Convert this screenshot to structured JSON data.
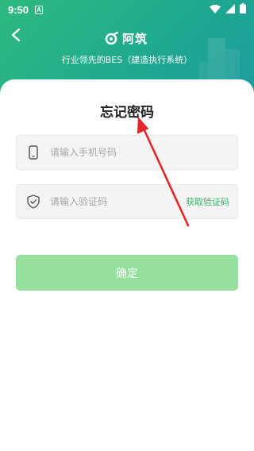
{
  "status_bar": {
    "time": "9:50",
    "app_badge": "A",
    "icons": [
      "wifi-icon",
      "signal-icon",
      "battery-icon"
    ]
  },
  "header": {
    "back_icon": "chevron-left-icon",
    "logo_text": "阿筑",
    "subtitle": "行业领先的BES（建造执行系统）"
  },
  "form": {
    "title": "忘记密码",
    "phone": {
      "placeholder": "请输入手机号码",
      "value": "",
      "icon": "phone-icon"
    },
    "code": {
      "placeholder": "请输入验证码",
      "value": "",
      "icon": "shield-check-icon"
    },
    "get_code_label": "获取验证码",
    "confirm_label": "确定"
  },
  "colors": {
    "header_gradient_start": "#2eb97e",
    "header_gradient_end": "#1e9aa0",
    "accent_green": "#2fb85f",
    "button_disabled": "#95e09d",
    "annotation_arrow": "#e5262b"
  }
}
